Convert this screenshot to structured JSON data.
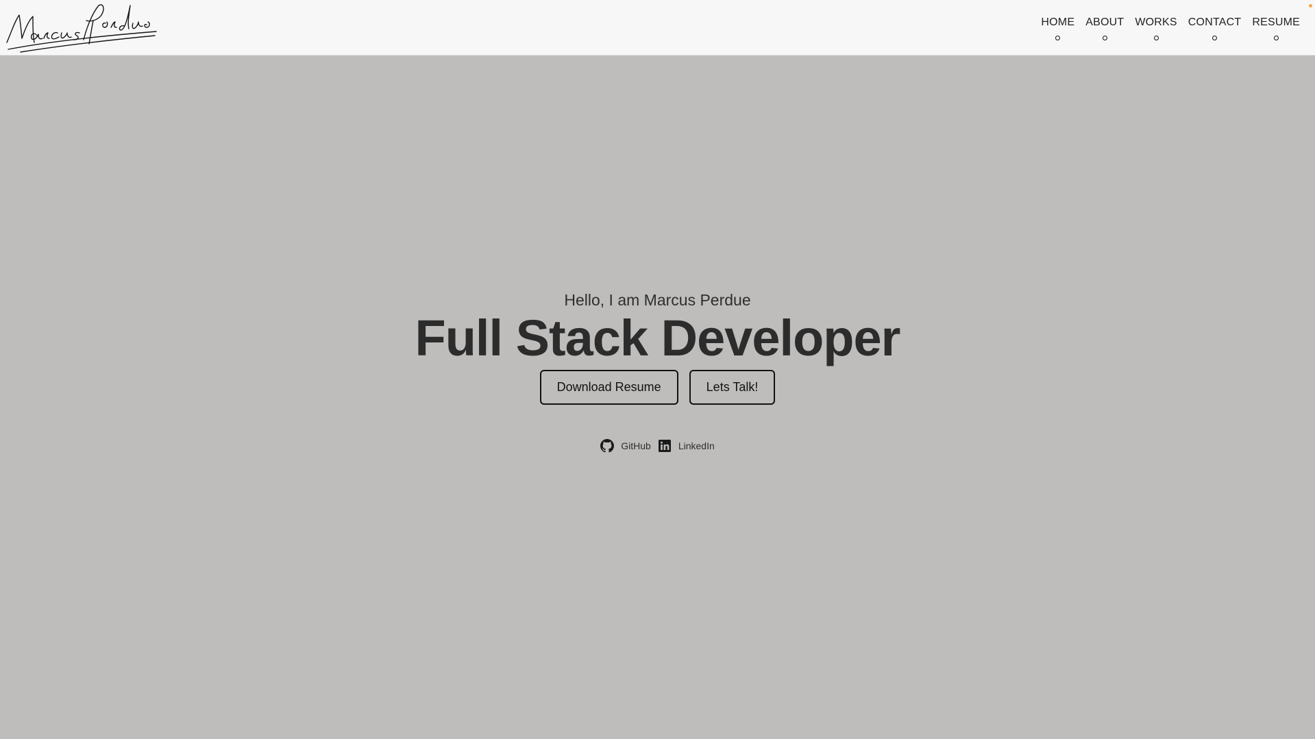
{
  "header": {
    "logo_text": "Marcus Perdue",
    "nav": [
      {
        "label": "HOME"
      },
      {
        "label": "ABOUT"
      },
      {
        "label": "WORKS"
      },
      {
        "label": "CONTACT"
      },
      {
        "label": "RESUME"
      }
    ]
  },
  "hero": {
    "greeting": "Hello, I am Marcus Perdue",
    "headline": "Full Stack Developer",
    "buttons": {
      "download": "Download Resume",
      "talk": "Lets Talk!"
    },
    "social": [
      {
        "label": "GitHub",
        "icon": "github-icon"
      },
      {
        "label": "LinkedIn",
        "icon": "linkedin-icon"
      }
    ]
  },
  "colors": {
    "background": "#bebdbb",
    "header": "#f7f7f7",
    "text": "#2c2c2c",
    "accent_dot": "#f3a54a"
  }
}
